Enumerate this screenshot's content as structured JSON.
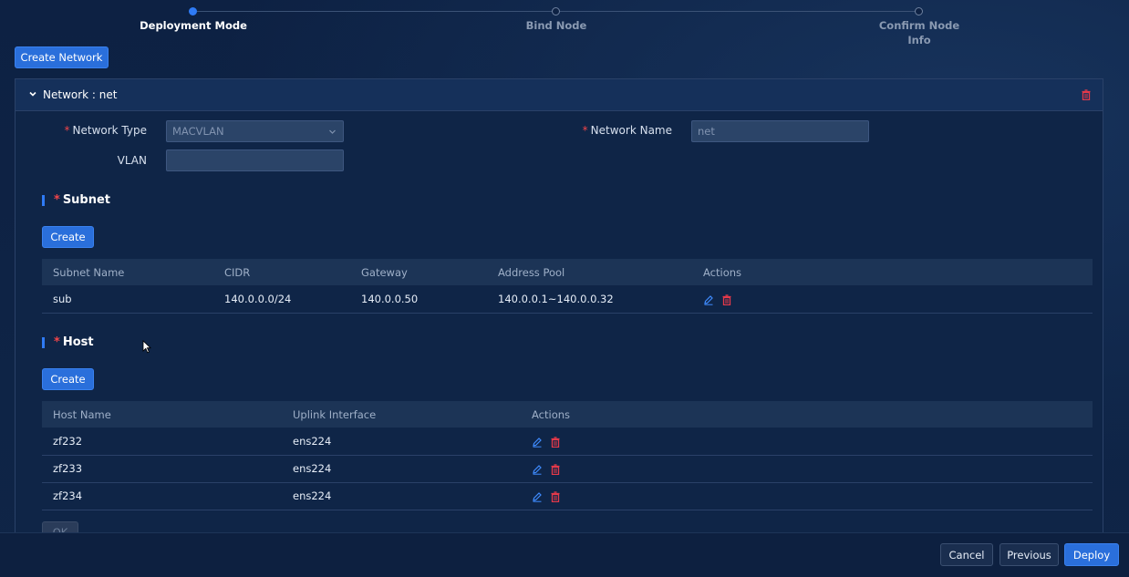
{
  "steps": [
    {
      "label": "Deployment Mode",
      "state": "active"
    },
    {
      "label": "Bind Node",
      "state": "pending"
    },
    {
      "label": "Confirm Node Info",
      "state": "pending"
    }
  ],
  "create_network_label": "Create Network",
  "network": {
    "header_title": "Network : net",
    "network_type_label": "Network Type",
    "network_type_value": "MACVLAN",
    "network_name_label": "Network Name",
    "network_name_value": "net",
    "vlan_label": "VLAN",
    "vlan_value": ""
  },
  "subnet": {
    "title": "Subnet",
    "create_label": "Create",
    "columns": [
      "Subnet Name",
      "CIDR",
      "Gateway",
      "Address Pool",
      "Actions"
    ],
    "rows": [
      {
        "name": "sub",
        "cidr": "140.0.0.0/24",
        "gateway": "140.0.0.50",
        "pool": "140.0.0.1~140.0.0.32"
      }
    ]
  },
  "host": {
    "title": "Host",
    "create_label": "Create",
    "columns": [
      "Host Name",
      "Uplink Interface",
      "Actions"
    ],
    "rows": [
      {
        "name": "zf232",
        "iface": "ens224"
      },
      {
        "name": "zf233",
        "iface": "ens224"
      },
      {
        "name": "zf234",
        "iface": "ens224"
      }
    ]
  },
  "ok_label": "OK",
  "footer": {
    "cancel": "Cancel",
    "previous": "Previous",
    "deploy": "Deploy"
  },
  "required_mark": "*",
  "colors": {
    "accent": "#2a6fdb",
    "danger": "#e5394a",
    "edit": "#3f8cff",
    "background": "#0e2244"
  },
  "icons": [
    "chevron-down-icon",
    "trash-icon",
    "edit-icon"
  ]
}
